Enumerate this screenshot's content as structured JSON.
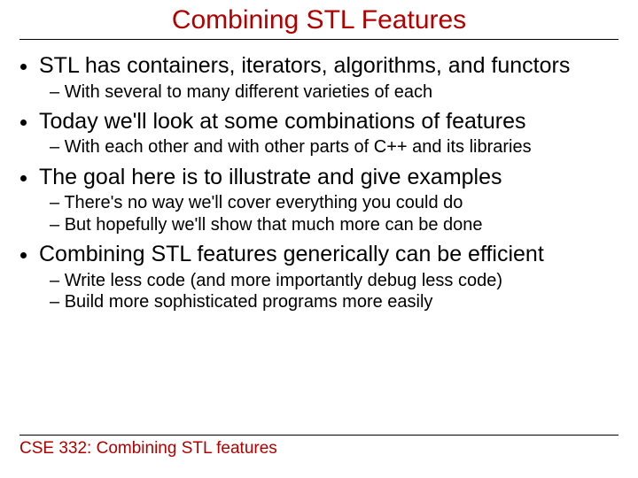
{
  "title": "Combining STL Features",
  "bullets": {
    "b1": "STL has containers, iterators, algorithms, and functors",
    "b1s1": "With several to many different varieties of each",
    "b2": "Today we'll look at some combinations of features",
    "b2s1": "With each other and with other parts of C++ and its libraries",
    "b3": "The goal here is to illustrate and give examples",
    "b3s1": "There's no way we'll cover everything you could do",
    "b3s2": "But hopefully we'll show that much more can be done",
    "b4": "Combining STL features generically can be efficient",
    "b4s1": "Write less code (and more importantly debug less code)",
    "b4s2": "Build more sophisticated programs more easily"
  },
  "footer": "CSE 332: Combining STL features"
}
